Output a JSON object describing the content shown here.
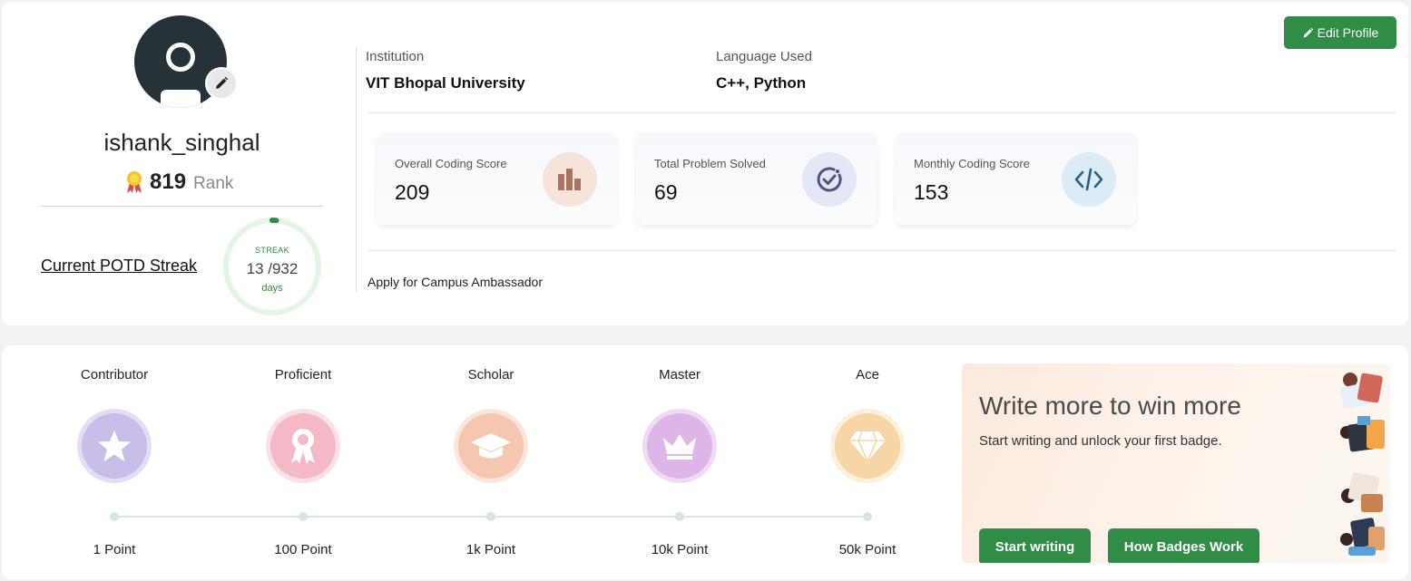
{
  "profile": {
    "username": "ishank_singhal",
    "rank_value": "819",
    "rank_label": "Rank",
    "potd_link": "Current POTD Streak",
    "streak": {
      "label": "STREAK",
      "value": "13 /932",
      "unit": "days",
      "current": 13,
      "total": 932
    }
  },
  "info": {
    "institution_label": "Institution",
    "institution_value": "VIT Bhopal University",
    "language_label": "Language Used",
    "language_value": "C++, Python"
  },
  "edit_button": "Edit Profile",
  "scores": [
    {
      "title": "Overall Coding Score",
      "value": "209",
      "icon": "bar-chart-icon",
      "icon_bg": "#f6e4da",
      "icon_color": "#a87560"
    },
    {
      "title": "Total Problem Solved",
      "value": "69",
      "icon": "check-circle-icon",
      "icon_bg": "#e4e8f6",
      "icon_color": "#4c5488"
    },
    {
      "title": "Monthly Coding Score",
      "value": "153",
      "icon": "code-icon",
      "icon_bg": "#dcecf7",
      "icon_color": "#2a5f86"
    }
  ],
  "ambassador_link": "Apply for Campus Ambassador",
  "badges": [
    {
      "name": "Contributor",
      "points": "1 Point",
      "icon": "star-icon",
      "ring": "#e4def5",
      "fill": "#c9bdea"
    },
    {
      "name": "Proficient",
      "points": "100 Point",
      "icon": "ribbon-icon",
      "ring": "#fbe0e6",
      "fill": "#f4b8c6"
    },
    {
      "name": "Scholar",
      "points": "1k Point",
      "icon": "graduation-cap-icon",
      "ring": "#fce6dc",
      "fill": "#f5c7b0"
    },
    {
      "name": "Master",
      "points": "10k Point",
      "icon": "crown-icon",
      "ring": "#efdcf3",
      "fill": "#dcb6e6"
    },
    {
      "name": "Ace",
      "points": "50k Point",
      "icon": "diamond-icon",
      "ring": "#fdf0dc",
      "fill": "#f5d6a4"
    }
  ],
  "promo": {
    "title": "Write more to win more",
    "subtitle": "Start writing and unlock your first badge.",
    "start_writing": "Start writing",
    "how_badges": "How Badges Work"
  },
  "colors": {
    "brand_green": "#2f8d46",
    "streak_ring": "#e3f6e6"
  }
}
